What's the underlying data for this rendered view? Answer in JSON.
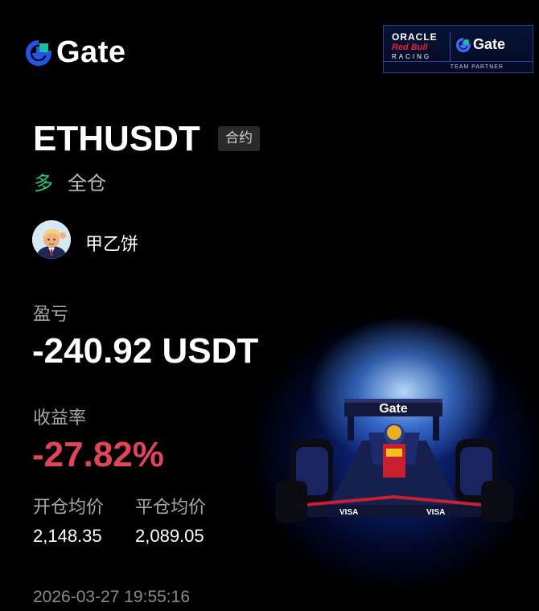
{
  "brand": {
    "name": "Gate",
    "accent": "#2354e6",
    "accent2": "#19c0a6"
  },
  "partner_badge": {
    "line1": "ORACLE",
    "line2": "Red Bull",
    "line3": "RACING",
    "gate": "Gate",
    "tag": "TEAM PARTNER"
  },
  "position": {
    "pair": "ETHUSDT",
    "type_tag": "合约",
    "side": "多",
    "margin_mode": "全仓"
  },
  "user": {
    "name": "甲乙饼",
    "avatar_icon": "user-avatar"
  },
  "pnl": {
    "label": "盈亏",
    "value": "-240.92 USDT"
  },
  "roi": {
    "label": "收益率",
    "value": "-27.82%",
    "color": "#e2455b"
  },
  "prices": {
    "open_label": "开仓均价",
    "open_value": "2,148.35",
    "close_label": "平仓均价",
    "close_value": "2,089.05"
  },
  "timestamp": "2026-03-27 19:55:16",
  "colors": {
    "long": "#2fc97c",
    "loss": "#e2455b",
    "bg": "#000000"
  }
}
